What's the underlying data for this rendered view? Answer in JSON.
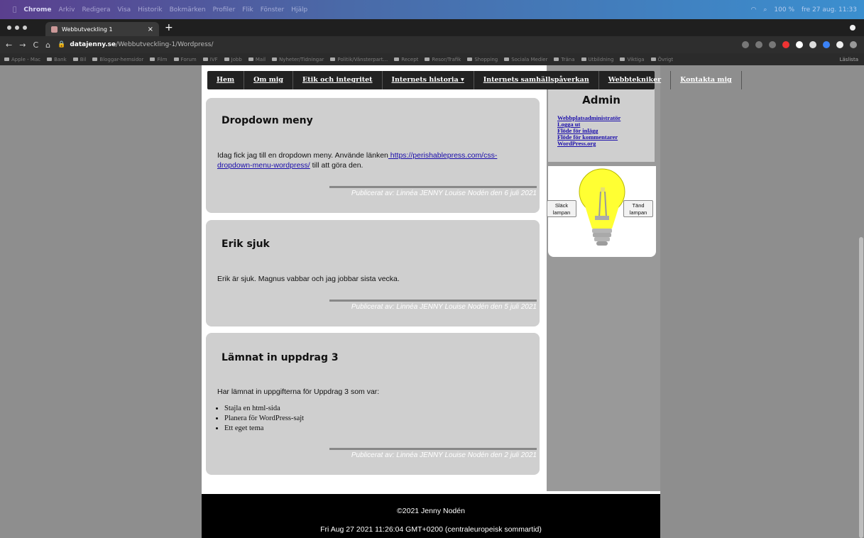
{
  "menubar": {
    "items": [
      "Chrome",
      "Arkiv",
      "Redigera",
      "Visa",
      "Historik",
      "Bokmärken",
      "Profiler",
      "Flik",
      "Fönster",
      "Hjälp"
    ],
    "battery": "100 %",
    "clock": "fre 27 aug. 11:33"
  },
  "browser": {
    "tab_title": "Webbutveckling 1",
    "url_host": "datajenny.se",
    "url_path": "/Webbutveckling-1/Wordpress/",
    "bookmarks": [
      "Apple - Mac",
      "Bank",
      "Bil",
      "Bloggar-hemsidor",
      "Film",
      "Forum",
      "IVF",
      "Jobb",
      "Mail",
      "Nyheter/Tidningar",
      "Politik/Vänsterpart...",
      "Recept",
      "Resor/Trafik",
      "Shopping",
      "Sociala Medier",
      "Träna",
      "Utbildning",
      "Viktiga",
      "Övrigt"
    ],
    "reading_list": "Läslista"
  },
  "nav": {
    "items": [
      "Hem",
      "Om mig",
      "Etik och integritet",
      "Internets historia ▾",
      "Internets samhällspåverkan",
      "Webbtekniker",
      "Kontakta mig"
    ]
  },
  "posts": [
    {
      "title": "Dropdown meny",
      "text_before": "Idag fick jag till en dropdown meny. Använde länken",
      "link": " https://perishablepress.com/css-dropdown-menu-wordpress/",
      "text_after": " till att göra den.",
      "meta": "Publicerat av: Linnéa JENNY Louise Nodén den 6 juli 2021"
    },
    {
      "title": "Erik sjuk",
      "text": "Erik är sjuk. Magnus vabbar och jag jobbar sista vecka.",
      "meta": "Publicerat av: Linnéa JENNY Louise Nodén den 5 juli 2021"
    },
    {
      "title": "Lämnat in uppdrag 3",
      "text": "Har lämnat in uppgifterna för Uppdrag 3 som var:",
      "list": [
        "Stajla en html-sida",
        "Planera för WordPress-sajt",
        "Ett eget tema"
      ],
      "meta": "Publicerat av: Linnéa JENNY Louise Nodén den 2 juli 2021"
    }
  ],
  "sidebar": {
    "admin_title": "Admin",
    "admin_links": [
      "Webbplatsadministratör",
      "Logga ut",
      "Flöde för inlägg",
      "Flöde för kommentarer",
      "WordPress.org"
    ],
    "lamp_off_label": "Släck lampan",
    "lamp_on_label": "Tänd lampan"
  },
  "footer": {
    "copyright": "©2021 Jenny Nodén",
    "datetime": "Fri Aug 27 2021 11:26:04 GMT+0200 (centraleuropeisk sommartid)"
  },
  "colors": {
    "post_bg": "#cfcfcf",
    "nav_bg": "#222222",
    "link": "#1a0dab",
    "lamp_yellow": "#ffff33"
  }
}
